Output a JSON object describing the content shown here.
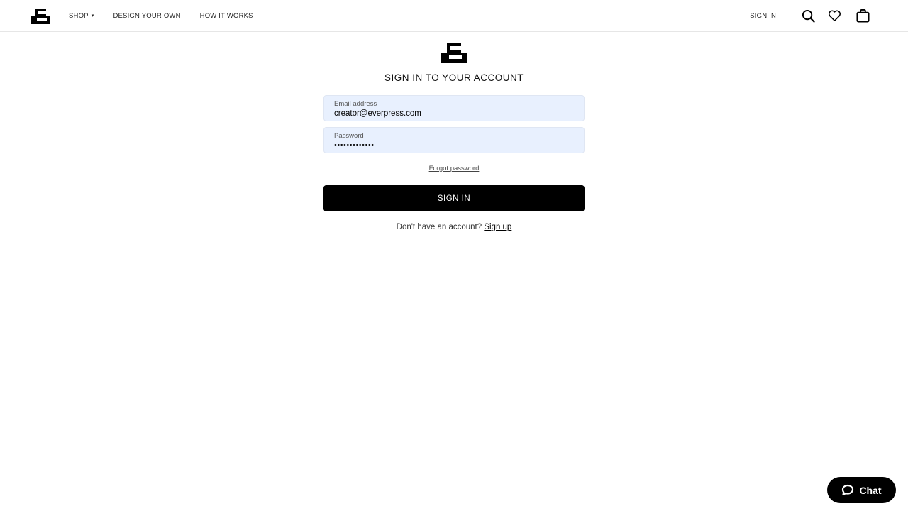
{
  "header": {
    "logo": "everpress-logo",
    "nav": [
      {
        "label": "SHOP",
        "has_dropdown": true,
        "caret": "▾"
      },
      {
        "label": "DESIGN YOUR OWN",
        "has_dropdown": false
      },
      {
        "label": "HOW IT WORKS",
        "has_dropdown": false
      }
    ],
    "sign_in_label": "SIGN IN",
    "icons": [
      "search-icon",
      "heart-icon",
      "bag-icon"
    ]
  },
  "login": {
    "title": "SIGN IN TO YOUR ACCOUNT",
    "email": {
      "label": "Email address",
      "value": "creator@everpress.com"
    },
    "password": {
      "label": "Password",
      "value": "•••••••••••••"
    },
    "forgot_label": "Forgot password",
    "submit_label": "SIGN IN",
    "signup_prompt": "Don't have an account?",
    "signup_link": "Sign up"
  },
  "chat": {
    "label": "Chat"
  },
  "colors": {
    "input_bg": "#e8f0fe",
    "button_bg": "#000000",
    "text": "#000000"
  }
}
